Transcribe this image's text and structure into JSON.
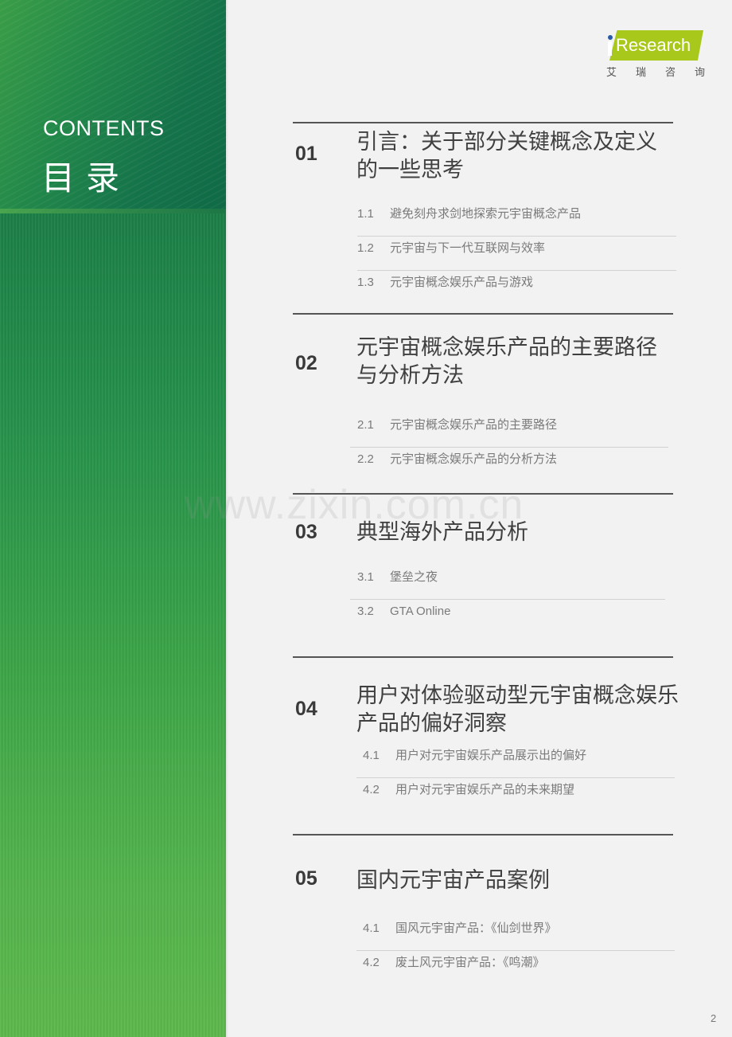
{
  "sidebar": {
    "heading_en": "CONTENTS",
    "heading_zh": "目录"
  },
  "logo": {
    "brand": "Research",
    "subtitle": [
      "艾",
      "瑞",
      "咨",
      "询"
    ],
    "accent_color": "#a8c81c"
  },
  "sections": [
    {
      "num": "01",
      "title": "引言：关于部分关键概念及定义的一些思考",
      "items": [
        {
          "num": "1.1",
          "label": "避免刻舟求剑地探索元宇宙概念产品"
        },
        {
          "num": "1.2",
          "label": "元宇宙与下一代互联网与效率"
        },
        {
          "num": "1.3",
          "label": "元宇宙概念娱乐产品与游戏"
        }
      ]
    },
    {
      "num": "02",
      "title": "元宇宙概念娱乐产品的主要路径与分析方法",
      "items": [
        {
          "num": "2.1",
          "label": "元宇宙概念娱乐产品的主要路径"
        },
        {
          "num": "2.2",
          "label": "元宇宙概念娱乐产品的分析方法"
        }
      ]
    },
    {
      "num": "03",
      "title": "典型海外产品分析",
      "items": [
        {
          "num": "3.1",
          "label": "堡垒之夜"
        },
        {
          "num": "3.2",
          "label": "GTA Online"
        }
      ]
    },
    {
      "num": "04",
      "title": "用户对体验驱动型元宇宙概念娱乐产品的偏好洞察",
      "items": [
        {
          "num": "4.1",
          "label": "用户对元宇宙娱乐产品展示出的偏好"
        },
        {
          "num": "4.2",
          "label": "用户对元宇宙娱乐产品的未来期望"
        }
      ]
    },
    {
      "num": "05",
      "title": "国内元宇宙产品案例",
      "items": [
        {
          "num": "4.1",
          "label": "国风元宇宙产品：《仙剑世界》"
        },
        {
          "num": "4.2",
          "label": "废土风元宇宙产品：《鸣潮》"
        }
      ]
    }
  ],
  "watermark": "www.zixin.com.cn",
  "page_number": "2"
}
